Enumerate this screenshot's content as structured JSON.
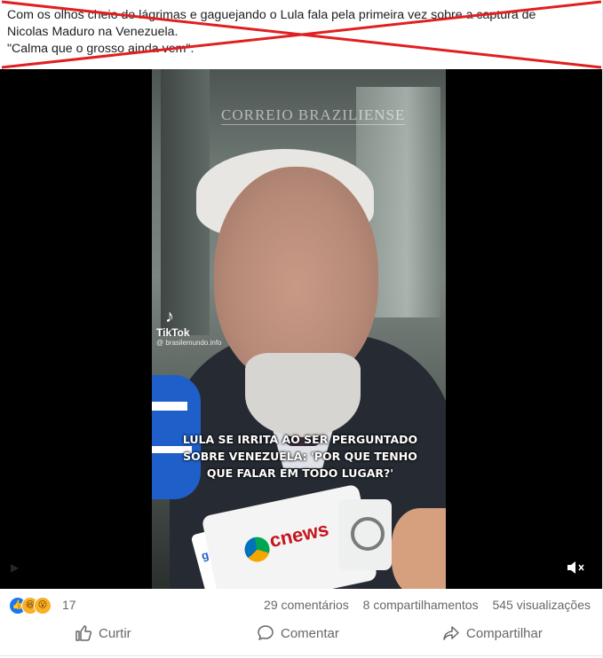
{
  "post": {
    "line1": "Com os olhos cheio de lágrimas e gaguejando o Lula fala pela primeira vez sobre a captura de",
    "line2": "Nicolas Maduro na Venezuela.",
    "line3": "\"Calma que o grosso ainda vem\"."
  },
  "video": {
    "watermark": "CORREIO BRAZILIENSE",
    "tiktok_label": "TikTok",
    "tiktok_handle": "@ brasilemundo.info",
    "caption_line1": "LULA SE IRRITA AO SER PERGUNTADO",
    "caption_line2": "SOBRE VENEZUELA: 'POR QUE TENHO",
    "caption_line3": "QUE FALAR EM TODO LUGAR?'",
    "mic_cnn": "cnews",
    "mic_gov": "gov"
  },
  "stats": {
    "reaction_count": "17",
    "comments": "29 comentários",
    "shares": "8 compartilhamentos",
    "views": "545 visualizações"
  },
  "actions": {
    "like": "Curtir",
    "comment": "Comentar",
    "share": "Compartilhar"
  },
  "colors": {
    "cross": "#e02020",
    "like_blue": "#1877f2",
    "meta_text": "#65676b"
  }
}
